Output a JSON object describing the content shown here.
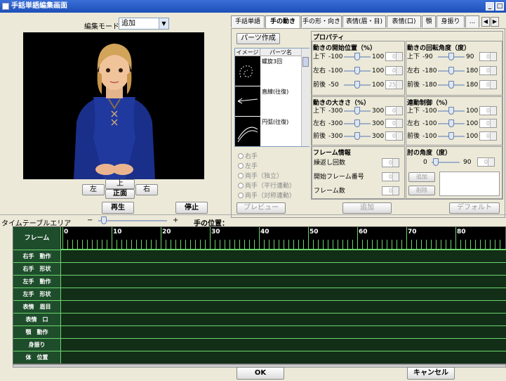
{
  "window": {
    "title": "手話単語編集画面"
  },
  "edit_mode": {
    "label": "編集モード",
    "value": "追加"
  },
  "view_buttons": {
    "left": "左",
    "up": "上",
    "front": "正面",
    "right": "右"
  },
  "play": {
    "play": "再生",
    "stop": "停止"
  },
  "tabs": [
    {
      "label": "手話単語"
    },
    {
      "label": "手の動き"
    },
    {
      "label": "手の形・向き"
    },
    {
      "label": "表情(眉・目)"
    },
    {
      "label": "表情(口)"
    },
    {
      "label": "顎"
    },
    {
      "label": "身振り"
    },
    {
      "label": "..."
    }
  ],
  "parts": {
    "create_button": "パーツ作成",
    "col_image": "イメージ",
    "col_name": "パーツ名",
    "items": [
      {
        "name": "螺旋3回"
      },
      {
        "name": "直線(往復)"
      },
      {
        "name": "円弧(往復)"
      }
    ]
  },
  "hands": {
    "right": "右手",
    "left": "左手",
    "both_indep": "両手（独立）",
    "both_parallel": "両手（平行連動）",
    "both_symmetric": "両手（対称連動）"
  },
  "buttons": {
    "preview": "プレビュー",
    "add": "追加",
    "default": "デフォルト",
    "ok": "OK",
    "cancel": "キャンセル"
  },
  "property": {
    "title": "プロパティ",
    "start_pos": {
      "title": "動きの開始位置（%）",
      "rows": [
        {
          "label": "上下",
          "min": "-100",
          "max": "100",
          "value": "0",
          "fraction": 0.5
        },
        {
          "label": "左右",
          "min": "-100",
          "max": "100",
          "value": "0",
          "fraction": 0.5
        },
        {
          "label": "前後",
          "min": "-50",
          "max": "100",
          "value": "25",
          "fraction": 0.5
        }
      ]
    },
    "rotation": {
      "title": "動きの回転角度（度）",
      "rows": [
        {
          "label": "上下",
          "min": "-90",
          "max": "90",
          "value": "0",
          "fraction": 0.5
        },
        {
          "label": "左右",
          "min": "-180",
          "max": "180",
          "value": "0",
          "fraction": 0.5
        },
        {
          "label": "前後",
          "min": "-180",
          "max": "180",
          "value": "0",
          "fraction": 0.5
        }
      ]
    },
    "size": {
      "title": "動きの大きさ（%）",
      "rows": [
        {
          "label": "上下",
          "min": "-300",
          "max": "300",
          "value": "0",
          "fraction": 0.5
        },
        {
          "label": "左右",
          "min": "-300",
          "max": "300",
          "value": "0",
          "fraction": 0.5
        },
        {
          "label": "前後",
          "min": "-300",
          "max": "300",
          "value": "0",
          "fraction": 0.5
        }
      ]
    },
    "linked": {
      "title": "連動制御（%）",
      "rows": [
        {
          "label": "上下",
          "min": "-100",
          "max": "100",
          "value": "0",
          "fraction": 0.5
        },
        {
          "label": "左右",
          "min": "-100",
          "max": "100",
          "value": "0",
          "fraction": 0.5
        },
        {
          "label": "前後",
          "min": "-100",
          "max": "100",
          "value": "0",
          "fraction": 0.5
        }
      ]
    },
    "frame": {
      "title": "フレーム情報",
      "repeat": "繰返し回数",
      "start_frame": "開始フレーム番号",
      "count": "フレーム数",
      "repeat_value": "0",
      "start_value": "0",
      "count_value": "0"
    },
    "elbow": {
      "title": "肘の角度（度）",
      "min": "0",
      "max": "90",
      "value": "0",
      "fraction": 0.05,
      "add": "追加",
      "delete": "削除"
    }
  },
  "timeline": {
    "area_label": "タイムテーブルエリア",
    "minus": "−",
    "plus": "+",
    "hand_pos": "手の位置：",
    "frame_label": "フレーム",
    "ticks": [
      "0",
      "10",
      "20",
      "30",
      "40",
      "50",
      "60",
      "70",
      "80"
    ],
    "rows": [
      {
        "label": "右手　動作"
      },
      {
        "label": "右手　形状"
      },
      {
        "label": "左手　動作"
      },
      {
        "label": "左手　形状"
      },
      {
        "label": "表情　眉目"
      },
      {
        "label": "表情　口"
      },
      {
        "label": "顎　動作"
      },
      {
        "label": "身振り"
      },
      {
        "label": "体　位置"
      }
    ]
  }
}
